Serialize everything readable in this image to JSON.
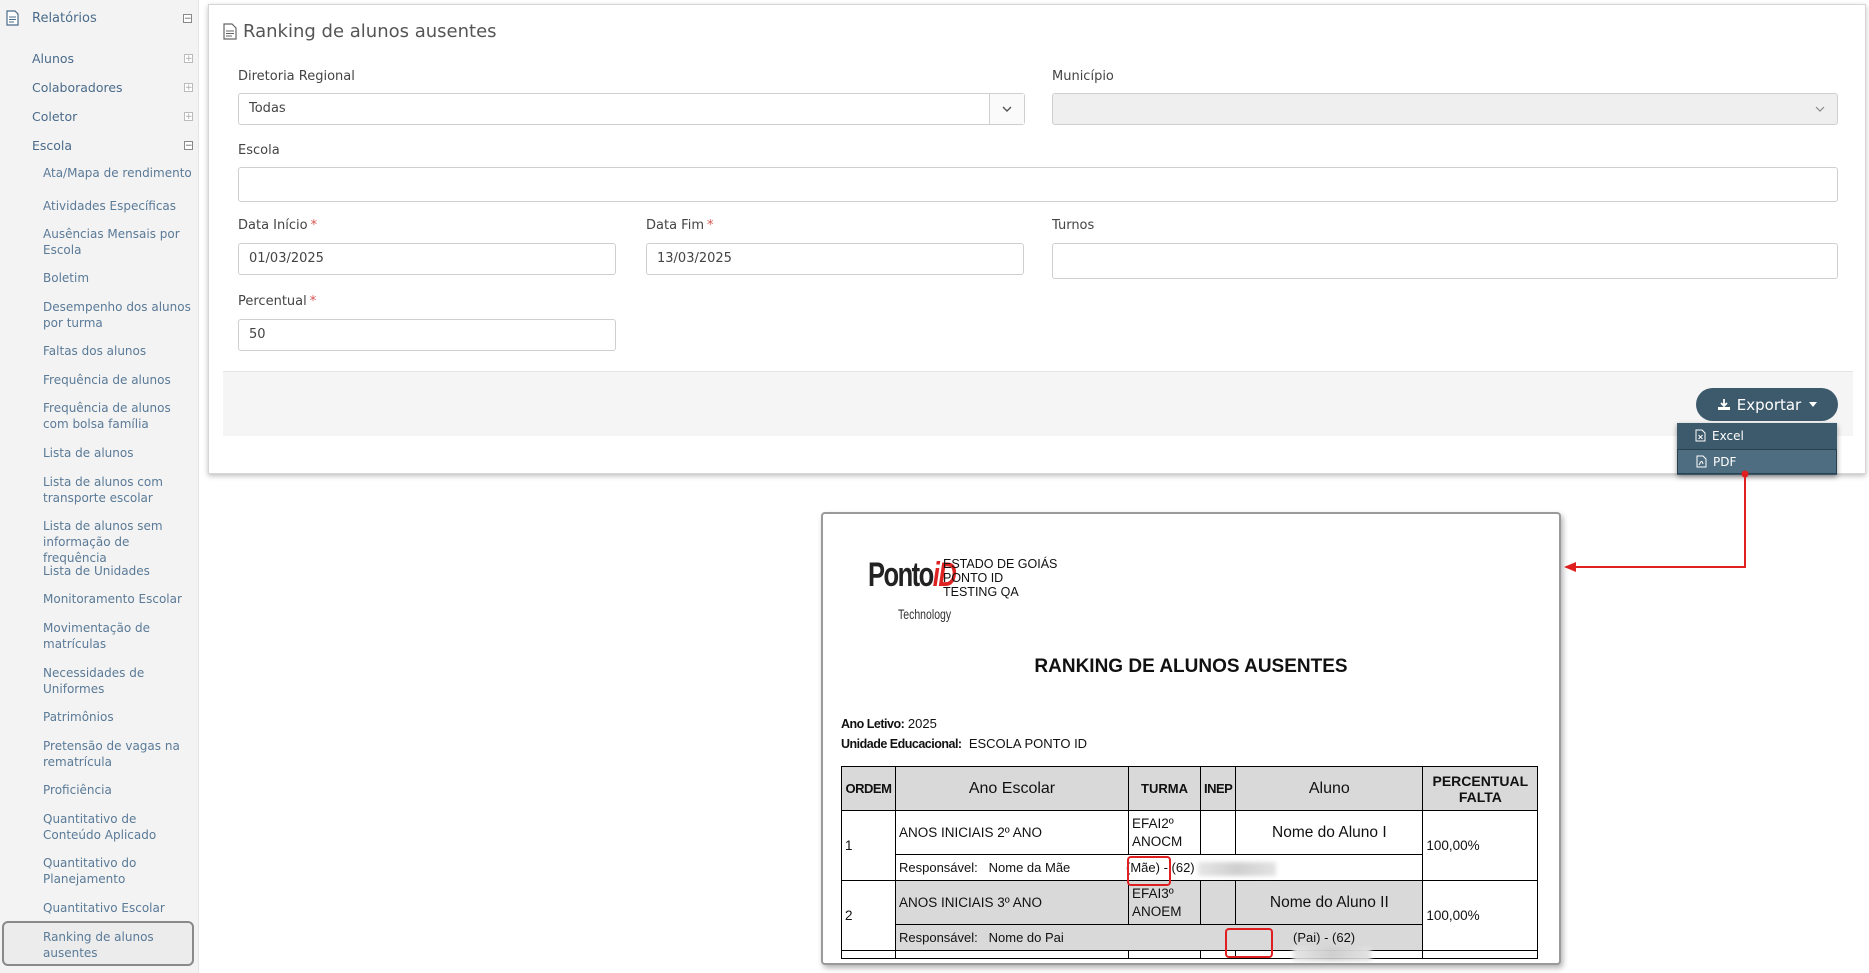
{
  "sidebar": {
    "section_label": "Relatórios",
    "items": [
      {
        "label": "Alunos",
        "expanded": false
      },
      {
        "label": "Colaboradores",
        "expanded": false
      },
      {
        "label": "Coletor",
        "expanded": false
      },
      {
        "label": "Escola",
        "expanded": true
      }
    ],
    "sub_items": [
      "Ata/Mapa de rendimento",
      "Atividades Específicas",
      "Ausências Mensais por Escola",
      "Boletim",
      "Desempenho dos alunos por turma",
      "Faltas dos alunos",
      "Frequência de alunos",
      "Frequência de alunos com bolsa família",
      "Lista de alunos",
      "Lista de alunos com transporte escolar",
      "Lista de alunos sem informação de frequência",
      "Lista de Unidades",
      "Monitoramento Escolar",
      "Movimentação de matrículas",
      "Necessidades de Uniformes",
      "Patrimônios",
      "Pretensão de vagas na rematrícula",
      "Proficiência",
      "Quantitativo de Conteúdo Aplicado",
      "Quantitativo do Planejamento",
      "Quantitativo Escolar",
      "Ranking de alunos ausentes"
    ],
    "active": "Ranking de alunos ausentes"
  },
  "form": {
    "title": "Ranking de alunos ausentes",
    "diretoria_label": "Diretoria Regional",
    "diretoria_value": "Todas",
    "municipio_label": "Município",
    "municipio_value": "",
    "escola_label": "Escola",
    "escola_value": "",
    "data_inicio_label": "Data Início",
    "data_inicio_value": "01/03/2025",
    "data_fim_label": "Data Fim",
    "data_fim_value": "13/03/2025",
    "turnos_label": "Turnos",
    "turnos_value": "",
    "percentual_label": "Percentual",
    "percentual_value": "50",
    "required_mark": "*"
  },
  "export": {
    "button_label": "Exportar",
    "options": [
      "Excel",
      "PDF"
    ],
    "selected": "PDF"
  },
  "report": {
    "logo_text": "Ponto",
    "logo_id": "iD",
    "logo_sub": "Technology",
    "org_lines": [
      "ESTADO DE GOIÁS",
      "PONTO ID",
      "TESTING QA"
    ],
    "title": "RANKING DE ALUNOS AUSENTES",
    "ano_letivo_label": "Ano Letivo:",
    "ano_letivo_value": "2025",
    "unidade_label": "Unidade Educacional:",
    "unidade_value": "ESCOLA PONTO ID",
    "columns": [
      "ORDEM",
      "Ano Escolar",
      "TURMA",
      "INEP",
      "Aluno",
      "PERCENTUAL FALTA"
    ],
    "responsavel_label": "Responsável:",
    "rows": [
      {
        "ordem": "1",
        "ano": "ANOS INICIAIS 2º ANO",
        "turma": "EFAI2º ANOCM",
        "inep": "",
        "aluno": "Nome do Aluno I",
        "percentual": "100,00%",
        "responsavel": "Nome da Mãe",
        "parentesco": "(Mãe)",
        "ddd": "- (62)"
      },
      {
        "ordem": "2",
        "ano": "ANOS INICIAIS 3º ANO",
        "turma": "EFAI3º ANOEM",
        "inep": "",
        "aluno": "Nome do Aluno II",
        "percentual": "100,00%",
        "responsavel": "Nome do Pai",
        "parentesco": "(Pai)",
        "ddd": "- (62)"
      }
    ]
  },
  "colors": {
    "accent": "#3d5a6c",
    "highlight": "#e02020",
    "link": "#4a6b8a"
  }
}
